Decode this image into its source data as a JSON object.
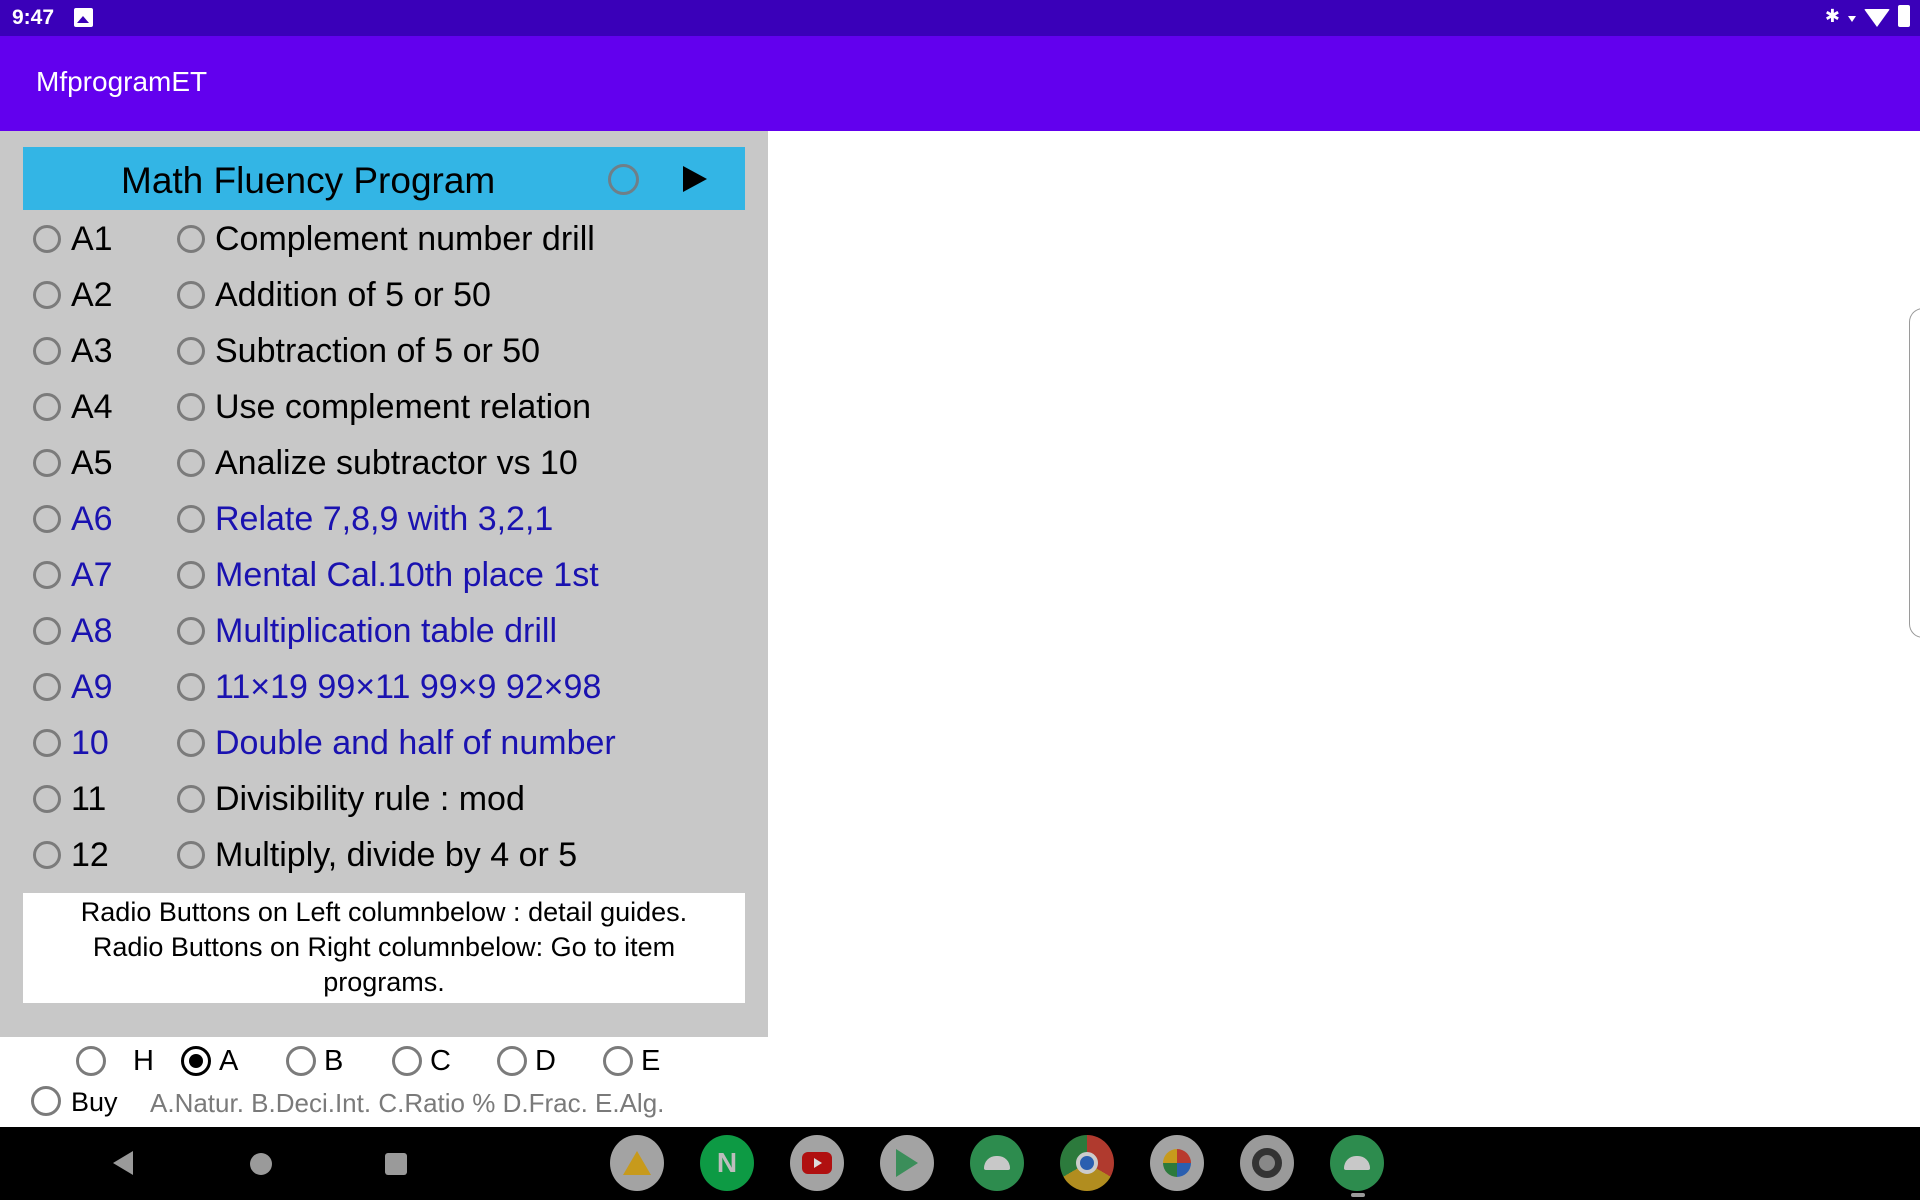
{
  "status_bar": {
    "time": "9:47",
    "left_icons": [
      "image-notification-icon"
    ],
    "right_icons": [
      "bluetooth-icon",
      "wifi-icon",
      "battery-icon"
    ]
  },
  "app_bar": {
    "title": "MfprogramET",
    "color": "#6200ee"
  },
  "panel": {
    "header": {
      "title": "Math Fluency Program",
      "radio_checked": false,
      "play_icon": "play-icon",
      "color": "#33b5e5"
    },
    "items": [
      {
        "code": "A1",
        "name": "Complement number drill",
        "highlight": false
      },
      {
        "code": "A2",
        "name": "Addition of 5 or 50",
        "highlight": false
      },
      {
        "code": "A3",
        "name": "Subtraction of 5 or 50",
        "highlight": false
      },
      {
        "code": "A4",
        "name": "Use complement relation",
        "highlight": false
      },
      {
        "code": "A5",
        "name": "Analize subtractor vs 10",
        "highlight": false
      },
      {
        "code": "A6",
        "name": "Relate 7,8,9 with 3,2,1",
        "highlight": true
      },
      {
        "code": "A7",
        "name": "Mental Cal.10th place 1st",
        "highlight": true
      },
      {
        "code": "A8",
        "name": "Multiplication table drill",
        "highlight": true
      },
      {
        "code": "A9",
        "name": "11×19 99×11 99×9 92×98",
        "highlight": true
      },
      {
        "code": "10",
        "name": "Double and half of number",
        "highlight": true
      },
      {
        "code": "11",
        "name": "Divisibility rule : mod",
        "highlight": false
      },
      {
        "code": "12",
        "name": "Multiply, divide by 4 or 5",
        "highlight": false
      }
    ],
    "highlight_color": "#1a12b0",
    "info_line1": "Radio Buttons on Left columnbelow : detail guides.",
    "info_line2": "Radio Buttons on Right columnbelow: Go to item",
    "info_line3": "programs."
  },
  "level_selector": {
    "options": [
      {
        "label": "H",
        "checked": false
      },
      {
        "label": "A",
        "checked": true
      },
      {
        "label": "B",
        "checked": false
      },
      {
        "label": "C",
        "checked": false
      },
      {
        "label": "D",
        "checked": false
      },
      {
        "label": "E",
        "checked": false
      }
    ],
    "buy_label": "Buy",
    "buy_checked": false,
    "legend": "A.Natur. B.Deci.Int. C.Ratio % D.Frac. E.Alg."
  },
  "nav_bar": {
    "buttons": [
      "back-icon",
      "home-icon",
      "recents-icon"
    ],
    "dock_apps": [
      "Drive",
      "Naver",
      "YouTube",
      "Play Store",
      "Android App",
      "Chrome",
      "Photos",
      "Settings",
      "Android App"
    ]
  }
}
